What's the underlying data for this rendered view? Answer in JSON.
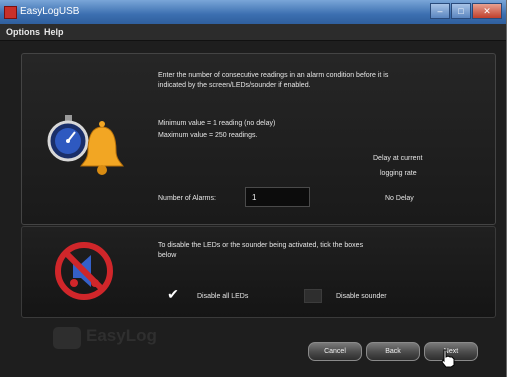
{
  "window": {
    "title": "EasyLogUSB",
    "min_glyph": "–",
    "max_glyph": "□",
    "close_glyph": "✕"
  },
  "menu": [
    "Options",
    "Help"
  ],
  "alarm_section": {
    "intro_line1": "Enter the number of consecutive readings in an alarm condition before it is",
    "intro_line2": "indicated by the screen/LEDs/sounder if enabled.",
    "min_text": "Minimum value = 1 reading (no delay)",
    "max_text": "Maximum value = 250 readings.",
    "delay_label_line1": "Delay at current",
    "delay_label_line2": "logging rate",
    "alarms_label": "Number of Alarms:",
    "alarms_value": "1",
    "delay_value": "No Delay"
  },
  "disable_section": {
    "intro_line1": "To disable the LEDs or the sounder being activated, tick the boxes",
    "intro_line2": "below",
    "leds_label": "Disable all LEDs",
    "leds_checked": true,
    "sounder_label": "Disable sounder",
    "sounder_checked": false,
    "check_glyph": "✔"
  },
  "brand": {
    "logo_text": "EasyLog"
  },
  "buttons": {
    "cancel": "Cancel",
    "back": "Back",
    "next": "Next"
  },
  "icons": {
    "stopwatch": "stopwatch-icon",
    "bell": "bell-icon",
    "muted": "muted-speaker-icon",
    "cursor": "hand-cursor-icon"
  }
}
